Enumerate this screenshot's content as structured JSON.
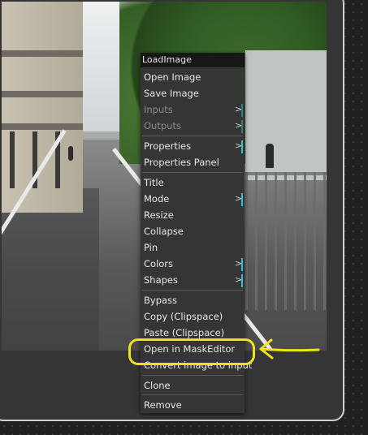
{
  "node": {
    "title": "LoadImage"
  },
  "menu": {
    "items": [
      {
        "label": "Open Image",
        "disabled": false,
        "submenu": false
      },
      {
        "label": "Save Image",
        "disabled": false,
        "submenu": false
      },
      {
        "label": "Inputs",
        "disabled": true,
        "submenu": true
      },
      {
        "label": "Outputs",
        "disabled": true,
        "submenu": true
      },
      {
        "label": "Properties",
        "disabled": false,
        "submenu": true
      },
      {
        "label": "Properties Panel",
        "disabled": false,
        "submenu": false
      },
      {
        "label": "Title",
        "disabled": false,
        "submenu": false
      },
      {
        "label": "Mode",
        "disabled": false,
        "submenu": true
      },
      {
        "label": "Resize",
        "disabled": false,
        "submenu": false
      },
      {
        "label": "Collapse",
        "disabled": false,
        "submenu": false
      },
      {
        "label": "Pin",
        "disabled": false,
        "submenu": false
      },
      {
        "label": "Colors",
        "disabled": false,
        "submenu": true
      },
      {
        "label": "Shapes",
        "disabled": false,
        "submenu": true
      },
      {
        "label": "Bypass",
        "disabled": false,
        "submenu": false
      },
      {
        "label": "Copy (Clipspace)",
        "disabled": false,
        "submenu": false
      },
      {
        "label": "Paste (Clipspace)",
        "disabled": false,
        "submenu": false
      },
      {
        "label": "Open in MaskEditor",
        "disabled": false,
        "submenu": false
      },
      {
        "label": "Convert image to input",
        "disabled": false,
        "submenu": false
      },
      {
        "label": "Clone",
        "disabled": false,
        "submenu": false
      },
      {
        "label": "Remove",
        "disabled": false,
        "submenu": false
      }
    ],
    "submenu_arrow": ">"
  },
  "annotation": {
    "color": "#f2e01b",
    "highlighted_item": "Open in MaskEditor"
  },
  "colors": {
    "menu_bg": "#353535",
    "title_bg": "#171717",
    "accent": "#2ec2d4"
  }
}
